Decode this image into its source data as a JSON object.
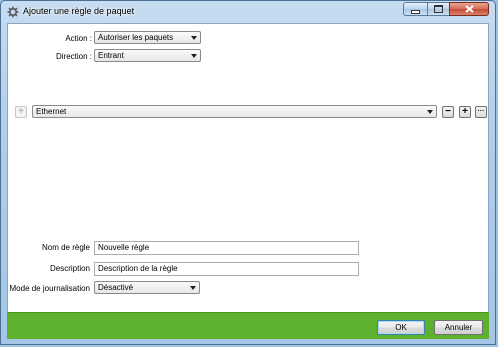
{
  "window": {
    "title": "Ajouter une règle de paquet"
  },
  "form": {
    "action": {
      "label": "Action :",
      "value": "Autoriser les paquets"
    },
    "direction": {
      "label": "Direction :",
      "value": "Entrant"
    },
    "protocol": {
      "value": "Ethernet"
    },
    "rule_name": {
      "label": "Nom de règle",
      "value": "Nouvelle règle"
    },
    "description": {
      "label": "Description",
      "value": "Description de la règle"
    },
    "logging_mode": {
      "label": "Mode de journalisation",
      "value": "Désactivé"
    }
  },
  "condition_buttons": {
    "add_disabled": "+",
    "remove": "−",
    "add": "+",
    "more": "···"
  },
  "footer": {
    "ok_label": "OK",
    "cancel_label": "Annuler",
    "color": "#5eb12e"
  }
}
